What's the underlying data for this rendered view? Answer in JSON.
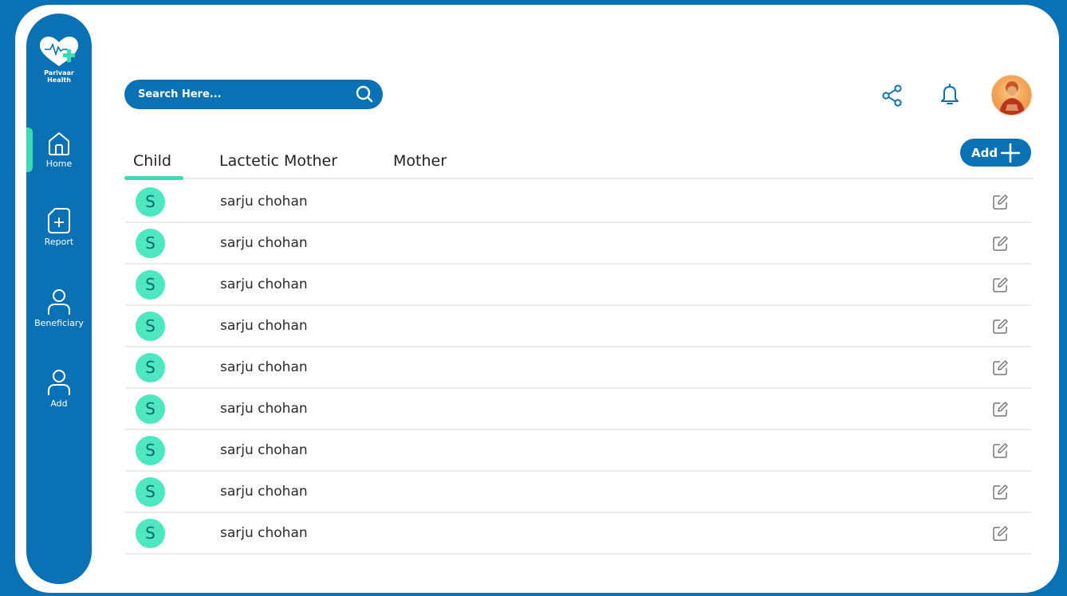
{
  "app": {
    "logo_line1": "Parivaar",
    "logo_line2": "Health"
  },
  "sidebar": {
    "items": [
      {
        "label": "Home",
        "icon": "home-icon",
        "active": true
      },
      {
        "label": "Report",
        "icon": "report-icon",
        "active": false
      },
      {
        "label": "Beneficiary",
        "icon": "user-icon",
        "active": false
      },
      {
        "label": "Add",
        "icon": "user-icon",
        "active": false
      }
    ]
  },
  "search": {
    "placeholder": "Search Here..."
  },
  "header": {
    "icons": [
      "share-icon",
      "bell-icon",
      "avatar"
    ]
  },
  "tabs": [
    {
      "label": "Child",
      "active": true
    },
    {
      "label": "Lactetic Mother",
      "active": false
    },
    {
      "label": "Mother",
      "active": false
    }
  ],
  "add_button": {
    "label": "Add"
  },
  "rows": [
    {
      "initial": "S",
      "name": "sarju chohan"
    },
    {
      "initial": "S",
      "name": "sarju chohan"
    },
    {
      "initial": "S",
      "name": "sarju chohan"
    },
    {
      "initial": "S",
      "name": "sarju chohan"
    },
    {
      "initial": "S",
      "name": "sarju chohan"
    },
    {
      "initial": "S",
      "name": "sarju chohan"
    },
    {
      "initial": "S",
      "name": "sarju chohan"
    },
    {
      "initial": "S",
      "name": "sarju chohan"
    },
    {
      "initial": "S",
      "name": "sarju chohan"
    }
  ],
  "colors": {
    "primary": "#0a72b4",
    "accent": "#3ddbb5",
    "avatar_bg": "#4de8c0"
  }
}
